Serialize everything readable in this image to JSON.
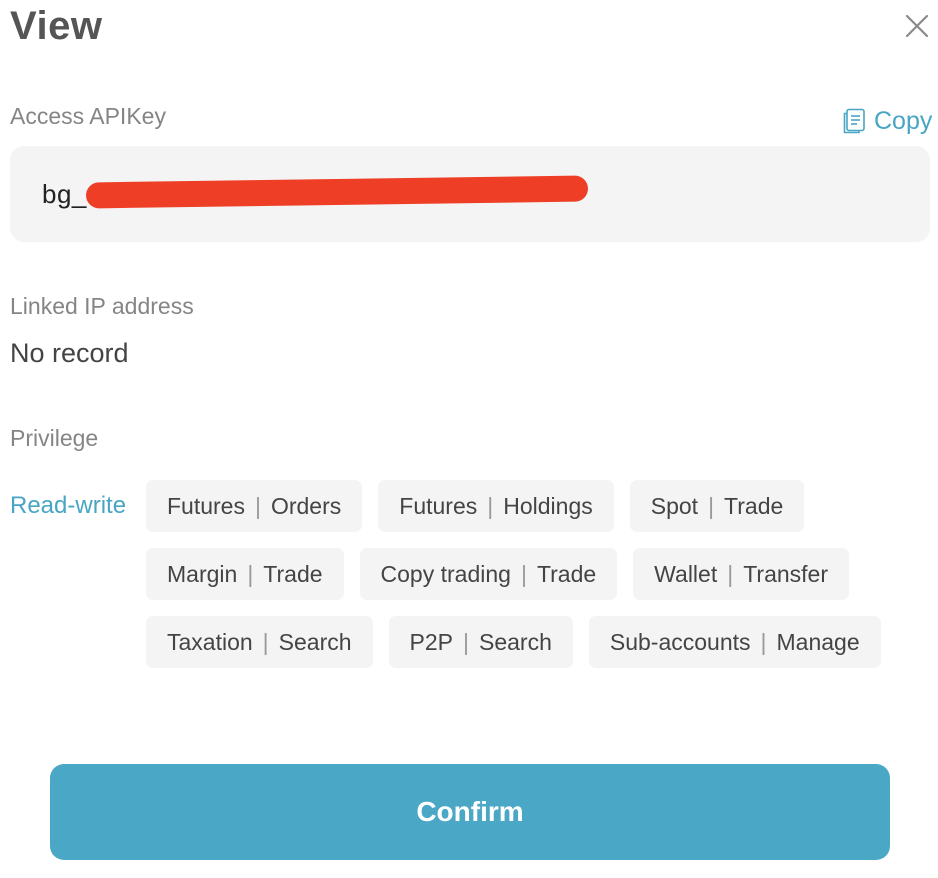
{
  "dialog": {
    "title": "View",
    "close_icon": "close-icon"
  },
  "apikey": {
    "label": "Access APIKey",
    "value_prefix": "bg_",
    "copy_label": "Copy",
    "copy_icon": "copy-icon"
  },
  "ip": {
    "label": "Linked IP address",
    "value": "No record"
  },
  "privilege": {
    "label": "Privilege",
    "level": "Read-write",
    "rows": [
      [
        {
          "category": "Futures",
          "action": "Orders"
        },
        {
          "category": "Futures",
          "action": "Holdings"
        },
        {
          "category": "Spot",
          "action": "Trade"
        }
      ],
      [
        {
          "category": "Margin",
          "action": "Trade"
        },
        {
          "category": "Copy trading",
          "action": "Trade"
        },
        {
          "category": "Wallet",
          "action": "Transfer"
        }
      ],
      [
        {
          "category": "Taxation",
          "action": "Search"
        },
        {
          "category": "P2P",
          "action": "Search"
        },
        {
          "category": "Sub-accounts",
          "action": "Manage"
        }
      ]
    ],
    "separator": "|"
  },
  "footer": {
    "confirm_label": "Confirm"
  },
  "colors": {
    "accent": "#4aa7c5",
    "redaction": "#ee3e25",
    "field_bg": "#f4f4f4"
  }
}
